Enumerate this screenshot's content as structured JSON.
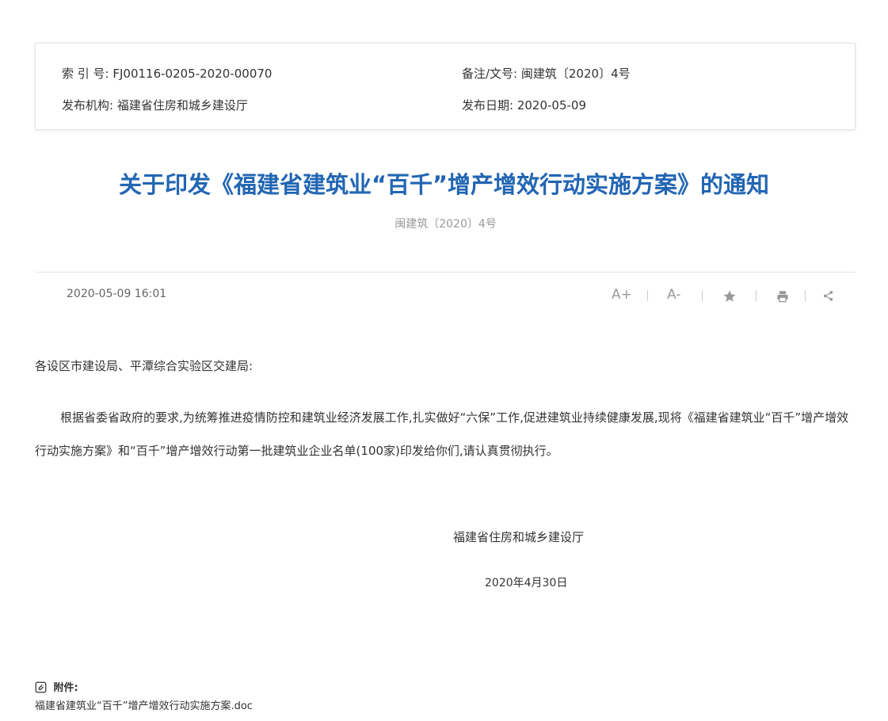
{
  "meta": {
    "index_label": "索 引 号:",
    "index_value": "FJ00116-0205-2020-00070",
    "remark_label": "备注/文号:",
    "remark_value": "闽建筑〔2020〕4号",
    "publisher_label": "发布机构:",
    "publisher_value": "福建省住房和城乡建设厅",
    "date_label": "发布日期:",
    "date_value": "2020-05-09"
  },
  "article": {
    "title": "关于印发《福建省建筑业“百千”增产增效行动实施方案》的通知",
    "doc_number": "闽建筑〔2020〕4号",
    "publish_time": "2020-05-09 16:01",
    "salutation": "各设区市建设局、平潭综合实验区交建局:",
    "body": "根据省委省政府的要求,为统筹推进疫情防控和建筑业经济发展工作,扎实做好“六保”工作,促进建筑业持续健康发展,现将《福建省建筑业“百千”增产增效行动实施方案》和“百千”增产增效行动第一批建筑业企业名单(100家)印发给你们,请认真贯彻执行。",
    "signature_org": "福建省住房和城乡建设厅",
    "signature_date": "2020年4月30日"
  },
  "toolbar": {
    "font_increase": "A+",
    "font_decrease": "A-",
    "icons": [
      "star-icon",
      "print-icon",
      "share-icon"
    ]
  },
  "attachments": {
    "heading": "附件:",
    "files": [
      "福建省建筑业“百千”增产增效行动实施方案.doc"
    ]
  },
  "colors": {
    "title": "#2266b3",
    "muted": "#999999"
  }
}
